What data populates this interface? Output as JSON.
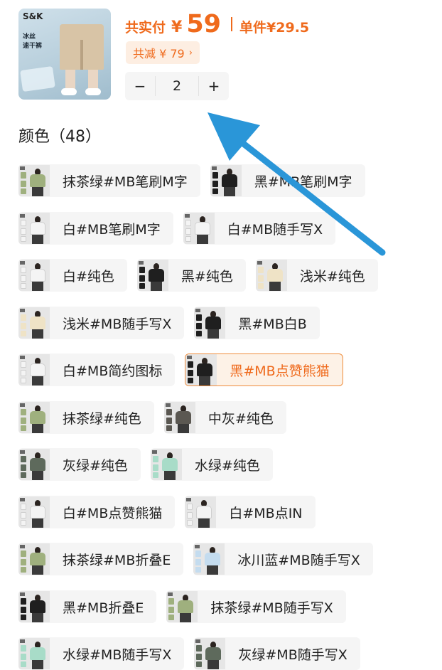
{
  "product": {
    "brand": "S&K",
    "tag_line1": "冰丝",
    "tag_line2": "速干裤"
  },
  "price": {
    "label": "共实付",
    "currency": "¥",
    "value": "59",
    "unit_price": "单件¥29.5",
    "color": "#ef6a1c"
  },
  "discount": {
    "label": "共减 ¥ 79",
    "chevron": "›"
  },
  "quantity": {
    "minus": "−",
    "value": "2",
    "plus": "+"
  },
  "section": {
    "title": "颜色（48）"
  },
  "options": [
    [
      {
        "label": "抹茶绿#MB笔刷M字",
        "shirt": "#9fb07e",
        "selected": false
      },
      {
        "label": "黑#MB笔刷M字",
        "shirt": "#1f1f1f",
        "selected": false
      }
    ],
    [
      {
        "label": "白#MB笔刷M字",
        "shirt": "#f4f4f4",
        "selected": false
      },
      {
        "label": "白#MB随手写X",
        "shirt": "#f4f4f4",
        "selected": false
      }
    ],
    [
      {
        "label": "白#纯色",
        "shirt": "#f4f4f4",
        "selected": false
      },
      {
        "label": "黑#纯色",
        "shirt": "#1f1f1f",
        "selected": false
      },
      {
        "label": "浅米#纯色",
        "shirt": "#efe3c6",
        "selected": false
      }
    ],
    [
      {
        "label": "浅米#MB随手写X",
        "shirt": "#efe3c6",
        "selected": false
      },
      {
        "label": "黑#MB白B",
        "shirt": "#1f1f1f",
        "selected": false
      }
    ],
    [
      {
        "label": "白#MB简约图标",
        "shirt": "#f4f4f4",
        "selected": false
      },
      {
        "label": "黑#MB点赞熊猫",
        "shirt": "#1f1f1f",
        "selected": true
      }
    ],
    [
      {
        "label": "抹茶绿#纯色",
        "shirt": "#9fb07e",
        "selected": false
      },
      {
        "label": "中灰#纯色",
        "shirt": "#5b5852",
        "selected": false
      }
    ],
    [
      {
        "label": "灰绿#纯色",
        "shirt": "#5e6a5c",
        "selected": false
      },
      {
        "label": "水绿#纯色",
        "shirt": "#a8dcc8",
        "selected": false
      }
    ],
    [
      {
        "label": "白#MB点赞熊猫",
        "shirt": "#f4f4f4",
        "selected": false
      },
      {
        "label": "白#MB点IN",
        "shirt": "#f4f4f4",
        "selected": false
      }
    ],
    [
      {
        "label": "抹茶绿#MB折叠E",
        "shirt": "#9fb07e",
        "selected": false
      },
      {
        "label": "冰川蓝#MB随手写X",
        "shirt": "#c4dcef",
        "selected": false
      }
    ],
    [
      {
        "label": "黑#MB折叠E",
        "shirt": "#1f1f1f",
        "selected": false
      },
      {
        "label": "抹茶绿#MB随手写X",
        "shirt": "#9fb07e",
        "selected": false
      }
    ],
    [
      {
        "label": "水绿#MB随手写X",
        "shirt": "#a8dcc8",
        "selected": false
      },
      {
        "label": "灰绿#MB随手写X",
        "shirt": "#5e6a5c",
        "selected": false
      }
    ]
  ]
}
